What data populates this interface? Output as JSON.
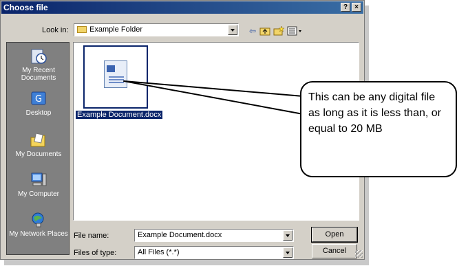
{
  "dialog": {
    "title": "Choose file",
    "help_button": "?",
    "close_button": "×"
  },
  "lookin": {
    "label": "Look in:",
    "value": "Example Folder"
  },
  "toolbar": {
    "icons": [
      "back-icon",
      "up-folder-icon",
      "new-folder-icon",
      "views-menu-icon"
    ]
  },
  "places": [
    {
      "label": "My Recent Documents",
      "icon": "recent-documents-icon"
    },
    {
      "label": "Desktop",
      "icon": "desktop-icon"
    },
    {
      "label": "My Documents",
      "icon": "my-documents-icon"
    },
    {
      "label": "My Computer",
      "icon": "my-computer-icon"
    },
    {
      "label": "My Network Places",
      "icon": "network-places-icon"
    }
  ],
  "files": [
    {
      "name": "Example Document.docx",
      "icon": "word-document-icon",
      "selected": true
    }
  ],
  "filename": {
    "label": "File name:",
    "value": "Example Document.docx"
  },
  "filetype": {
    "label": "Files of type:",
    "value": "All Files (*.*)"
  },
  "buttons": {
    "open": "Open",
    "cancel": "Cancel"
  },
  "callout": {
    "text": "This can be any digital file as long as it is less than, or equal to 20 MB"
  },
  "colors": {
    "titlebar": "#0a246a",
    "dialog_bg": "#d4d0c8",
    "places_bg": "#808080",
    "selection": "#0a246a"
  }
}
